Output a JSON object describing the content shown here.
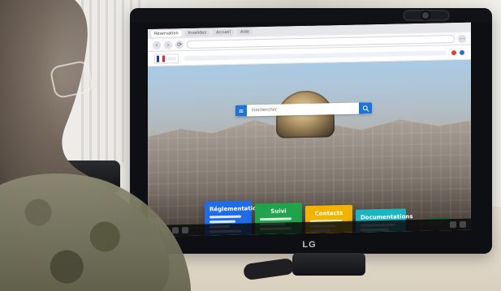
{
  "scene": {
    "monitor_brand": "LG"
  },
  "browser": {
    "tabs": [
      {
        "label": "Réservation"
      },
      {
        "label": "Invalides"
      },
      {
        "label": "Accueil"
      },
      {
        "label": "Aide"
      }
    ],
    "address_placeholder": ""
  },
  "site": {
    "search": {
      "placeholder": "Rechercher"
    },
    "tiles": [
      {
        "title": "Réglementation"
      },
      {
        "title": "Suivi"
      },
      {
        "title": "Contacts"
      },
      {
        "title": "Documentations"
      }
    ]
  },
  "colors": {
    "accent_blue": "#1f73d8",
    "tile_blue": "#1f6ce6",
    "tile_green": "#1fa44b",
    "tile_yellow": "#f3b400",
    "tile_teal": "#19b6c2"
  }
}
